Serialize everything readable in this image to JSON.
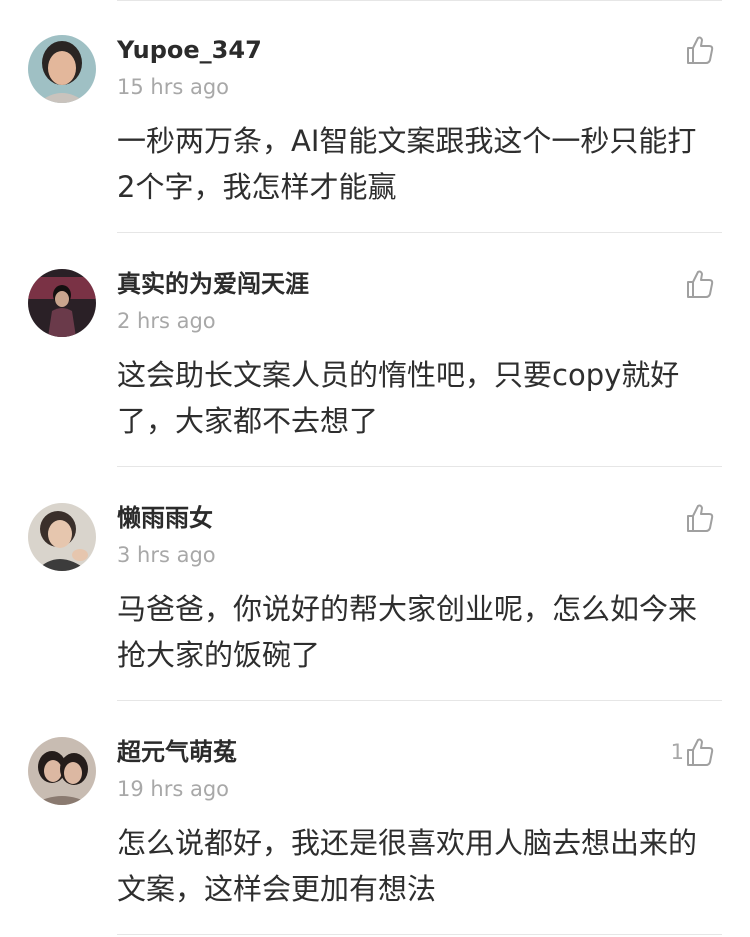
{
  "comments": [
    {
      "username": "Yupoe_347",
      "time": "15 hrs ago",
      "text": "一秒两万条，AI智能文案跟我这个一秒只能打2个字，我怎样才能赢",
      "likes": "",
      "avatar_colors": {
        "bg": "#9fc0c4",
        "skin": "#e3b79b",
        "hair": "#2a2523",
        "shirt": "#c9c3bd"
      }
    },
    {
      "username": "真实的为爱闯天涯",
      "time": "2 hrs ago",
      "text": "这会助长文案人员的惰性吧，只要copy就好了，大家都不去想了",
      "likes": "",
      "avatar_colors": {
        "bg": "#2a2026",
        "skin": "#c9a58e",
        "hair": "#141010",
        "shirt": "#6a3a4a"
      }
    },
    {
      "username": "懒雨雨女",
      "time": "3 hrs ago",
      "text": "马爸爸，你说好的帮大家创业呢，怎么如今来抢大家的饭碗了",
      "likes": "",
      "avatar_colors": {
        "bg": "#d9d4cc",
        "skin": "#e6c6ae",
        "hair": "#3a2f2a",
        "shirt": "#3c3c3c"
      }
    },
    {
      "username": "超元气萌菟",
      "time": "19 hrs ago",
      "text": "怎么说都好，我还是很喜欢用人脑去想出来的文案，这样会更加有想法",
      "likes": "1",
      "avatar_colors": {
        "bg": "#c8bcb2",
        "skin": "#dcb8a2",
        "hair": "#241c1a",
        "shirt": "#8a7a70"
      }
    }
  ],
  "colors": {
    "username": "#2b2b2b",
    "meta": "#a8a8a8",
    "text": "#2e2e2e",
    "divider": "#e6e6e6",
    "icon": "#a0a0a0"
  },
  "icons": {
    "like": "thumbs-up-icon"
  }
}
